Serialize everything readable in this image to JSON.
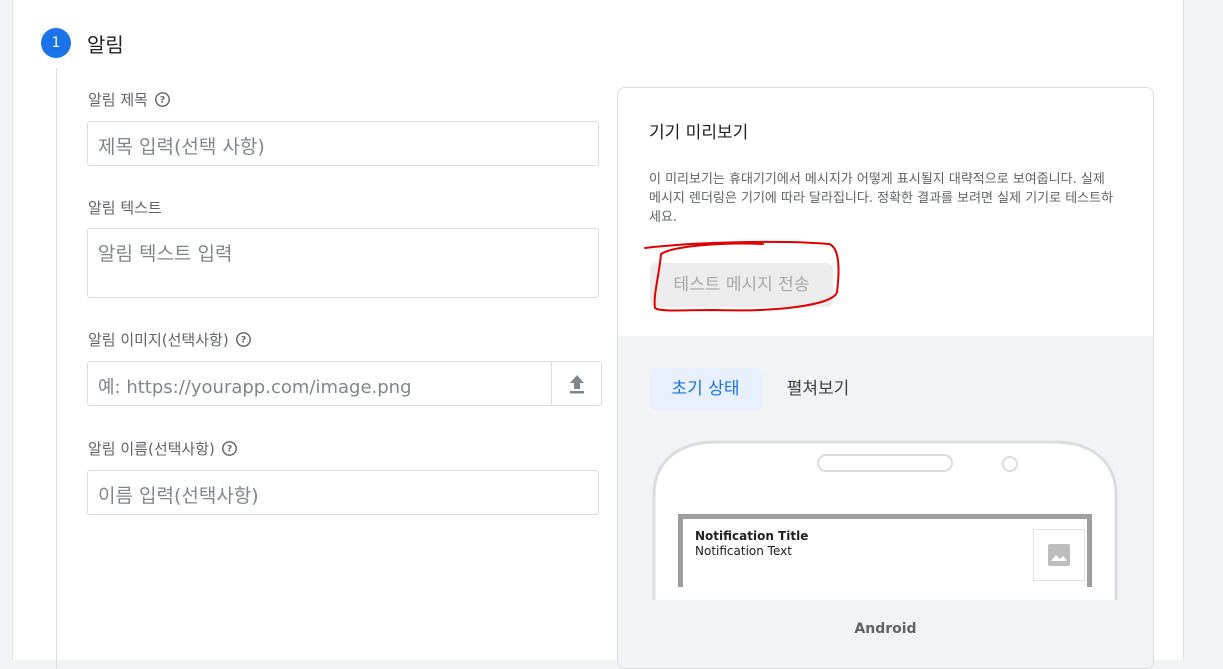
{
  "step": {
    "number": "1",
    "title": "알림"
  },
  "fields": {
    "title": {
      "label": "알림 제목",
      "placeholder": "제목 입력(선택 사항)"
    },
    "text": {
      "label": "알림 텍스트",
      "placeholder": "알림 텍스트 입력"
    },
    "image": {
      "label": "알림 이미지(선택사항)",
      "placeholder": "예: https://yourapp.com/image.png"
    },
    "name": {
      "label": "알림 이름(선택사항)",
      "placeholder": "이름 입력(선택사항)"
    }
  },
  "preview": {
    "title": "기기 미리보기",
    "description": "이 미리보기는 휴대기기에서 메시지가 어떻게 표시될지 대략적으로 보여줍니다. 실제 메시지 렌더링은 기기에 따라 달라집니다. 정확한 결과를 보려면 실제 기기로 테스트하세요.",
    "test_button": "테스트 메시지 전송",
    "tabs": [
      "초기 상태",
      "펼쳐보기"
    ],
    "notification": {
      "title": "Notification Title",
      "text": "Notification Text"
    },
    "platform": "Android"
  },
  "colors": {
    "accent": "#1a73e8",
    "annotation": "#e00000"
  },
  "icons": {
    "help": "help-circle-icon",
    "upload": "upload-icon",
    "image": "image-icon"
  }
}
